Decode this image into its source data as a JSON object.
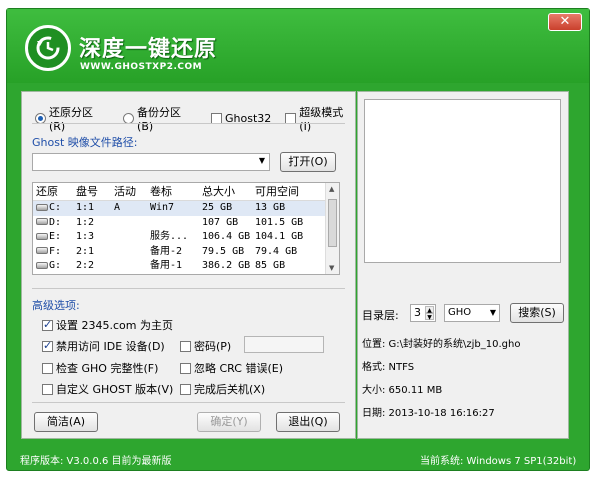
{
  "app": {
    "title": "深度一键还原",
    "url": "WWW.GHOSTXP2.COM",
    "close_label": "✕"
  },
  "mode": {
    "restore_label": "还原分区(R)",
    "backup_label": "备份分区(B)",
    "ghost32_label": "Ghost32",
    "super_label": "超级模式(I)",
    "selected": "restore"
  },
  "ghost_path": {
    "label": "Ghost 映像文件路径:",
    "value": "",
    "open_label": "打开(O)"
  },
  "partition_table": {
    "columns": [
      "还原",
      "盘号",
      "活动",
      "卷标",
      "总大小",
      "可用空间"
    ],
    "rows": [
      {
        "drive": "C:",
        "num": "1:1",
        "active": "A",
        "label": "Win7",
        "total": "25 GB",
        "free": "13 GB"
      },
      {
        "drive": "D:",
        "num": "1:2",
        "active": "",
        "label": "",
        "total": "107 GB",
        "free": "101.5 GB"
      },
      {
        "drive": "E:",
        "num": "1:3",
        "active": "",
        "label": "服务...",
        "total": "106.4 GB",
        "free": "104.1 GB"
      },
      {
        "drive": "F:",
        "num": "2:1",
        "active": "",
        "label": "备用-2",
        "total": "79.5 GB",
        "free": "79.4 GB"
      },
      {
        "drive": "G:",
        "num": "2:2",
        "active": "",
        "label": "备用-1",
        "total": "386.2 GB",
        "free": "85 GB"
      }
    ]
  },
  "advanced": {
    "title": "高级选项:",
    "set_homepage": "设置 2345.com 为主页",
    "disable_ide": "禁用访问 IDE 设备(D)",
    "password": "密码(P)",
    "check_gho": "检查 GHO 完整性(F)",
    "ignore_crc": "忽略 CRC 错误(E)",
    "custom_ghost": "自定义 GHOST 版本(V)",
    "shutdown": "完成后关机(X)"
  },
  "buttons": {
    "simple": "简洁(A)",
    "confirm": "确定(Y)",
    "exit": "退出(Q)",
    "search": "搜索(S)"
  },
  "right": {
    "dir_level_label": "目录层:",
    "dir_level_value": "3",
    "ext_value": "GHO",
    "location": "位置: G:\\封装好的系统\\zjb_10.gho",
    "format": "格式: NTFS",
    "size": "大小: 650.11 MB",
    "date": "日期: 2013-10-18   16:16:27"
  },
  "footer": {
    "version": "程序版本: V3.0.0.6  目前为最新版",
    "system": "当前系统: Windows 7 SP1(32bit)"
  },
  "colors": {
    "brand_green": "#2ea62f",
    "label_blue": "#1f4ea8"
  }
}
